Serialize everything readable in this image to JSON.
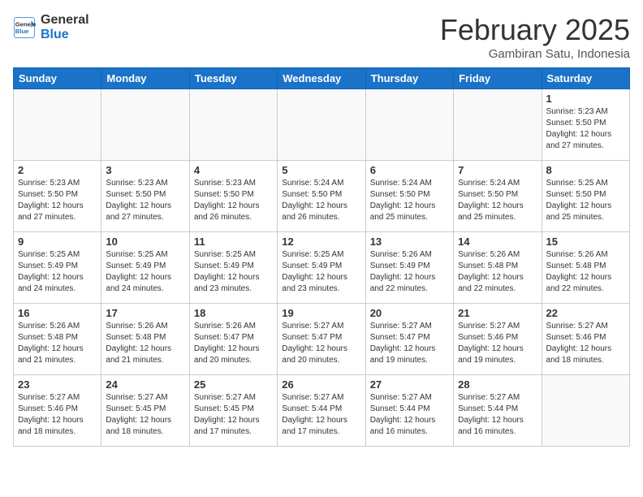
{
  "header": {
    "logo_line1": "General",
    "logo_line2": "Blue",
    "month": "February 2025",
    "location": "Gambiran Satu, Indonesia"
  },
  "weekdays": [
    "Sunday",
    "Monday",
    "Tuesday",
    "Wednesday",
    "Thursday",
    "Friday",
    "Saturday"
  ],
  "weeks": [
    [
      {
        "day": "",
        "info": ""
      },
      {
        "day": "",
        "info": ""
      },
      {
        "day": "",
        "info": ""
      },
      {
        "day": "",
        "info": ""
      },
      {
        "day": "",
        "info": ""
      },
      {
        "day": "",
        "info": ""
      },
      {
        "day": "1",
        "info": "Sunrise: 5:23 AM\nSunset: 5:50 PM\nDaylight: 12 hours\nand 27 minutes."
      }
    ],
    [
      {
        "day": "2",
        "info": "Sunrise: 5:23 AM\nSunset: 5:50 PM\nDaylight: 12 hours\nand 27 minutes."
      },
      {
        "day": "3",
        "info": "Sunrise: 5:23 AM\nSunset: 5:50 PM\nDaylight: 12 hours\nand 27 minutes."
      },
      {
        "day": "4",
        "info": "Sunrise: 5:23 AM\nSunset: 5:50 PM\nDaylight: 12 hours\nand 26 minutes."
      },
      {
        "day": "5",
        "info": "Sunrise: 5:24 AM\nSunset: 5:50 PM\nDaylight: 12 hours\nand 26 minutes."
      },
      {
        "day": "6",
        "info": "Sunrise: 5:24 AM\nSunset: 5:50 PM\nDaylight: 12 hours\nand 25 minutes."
      },
      {
        "day": "7",
        "info": "Sunrise: 5:24 AM\nSunset: 5:50 PM\nDaylight: 12 hours\nand 25 minutes."
      },
      {
        "day": "8",
        "info": "Sunrise: 5:25 AM\nSunset: 5:50 PM\nDaylight: 12 hours\nand 25 minutes."
      }
    ],
    [
      {
        "day": "9",
        "info": "Sunrise: 5:25 AM\nSunset: 5:49 PM\nDaylight: 12 hours\nand 24 minutes."
      },
      {
        "day": "10",
        "info": "Sunrise: 5:25 AM\nSunset: 5:49 PM\nDaylight: 12 hours\nand 24 minutes."
      },
      {
        "day": "11",
        "info": "Sunrise: 5:25 AM\nSunset: 5:49 PM\nDaylight: 12 hours\nand 23 minutes."
      },
      {
        "day": "12",
        "info": "Sunrise: 5:25 AM\nSunset: 5:49 PM\nDaylight: 12 hours\nand 23 minutes."
      },
      {
        "day": "13",
        "info": "Sunrise: 5:26 AM\nSunset: 5:49 PM\nDaylight: 12 hours\nand 22 minutes."
      },
      {
        "day": "14",
        "info": "Sunrise: 5:26 AM\nSunset: 5:48 PM\nDaylight: 12 hours\nand 22 minutes."
      },
      {
        "day": "15",
        "info": "Sunrise: 5:26 AM\nSunset: 5:48 PM\nDaylight: 12 hours\nand 22 minutes."
      }
    ],
    [
      {
        "day": "16",
        "info": "Sunrise: 5:26 AM\nSunset: 5:48 PM\nDaylight: 12 hours\nand 21 minutes."
      },
      {
        "day": "17",
        "info": "Sunrise: 5:26 AM\nSunset: 5:48 PM\nDaylight: 12 hours\nand 21 minutes."
      },
      {
        "day": "18",
        "info": "Sunrise: 5:26 AM\nSunset: 5:47 PM\nDaylight: 12 hours\nand 20 minutes."
      },
      {
        "day": "19",
        "info": "Sunrise: 5:27 AM\nSunset: 5:47 PM\nDaylight: 12 hours\nand 20 minutes."
      },
      {
        "day": "20",
        "info": "Sunrise: 5:27 AM\nSunset: 5:47 PM\nDaylight: 12 hours\nand 19 minutes."
      },
      {
        "day": "21",
        "info": "Sunrise: 5:27 AM\nSunset: 5:46 PM\nDaylight: 12 hours\nand 19 minutes."
      },
      {
        "day": "22",
        "info": "Sunrise: 5:27 AM\nSunset: 5:46 PM\nDaylight: 12 hours\nand 18 minutes."
      }
    ],
    [
      {
        "day": "23",
        "info": "Sunrise: 5:27 AM\nSunset: 5:46 PM\nDaylight: 12 hours\nand 18 minutes."
      },
      {
        "day": "24",
        "info": "Sunrise: 5:27 AM\nSunset: 5:45 PM\nDaylight: 12 hours\nand 18 minutes."
      },
      {
        "day": "25",
        "info": "Sunrise: 5:27 AM\nSunset: 5:45 PM\nDaylight: 12 hours\nand 17 minutes."
      },
      {
        "day": "26",
        "info": "Sunrise: 5:27 AM\nSunset: 5:44 PM\nDaylight: 12 hours\nand 17 minutes."
      },
      {
        "day": "27",
        "info": "Sunrise: 5:27 AM\nSunset: 5:44 PM\nDaylight: 12 hours\nand 16 minutes."
      },
      {
        "day": "28",
        "info": "Sunrise: 5:27 AM\nSunset: 5:44 PM\nDaylight: 12 hours\nand 16 minutes."
      },
      {
        "day": "",
        "info": ""
      }
    ]
  ]
}
